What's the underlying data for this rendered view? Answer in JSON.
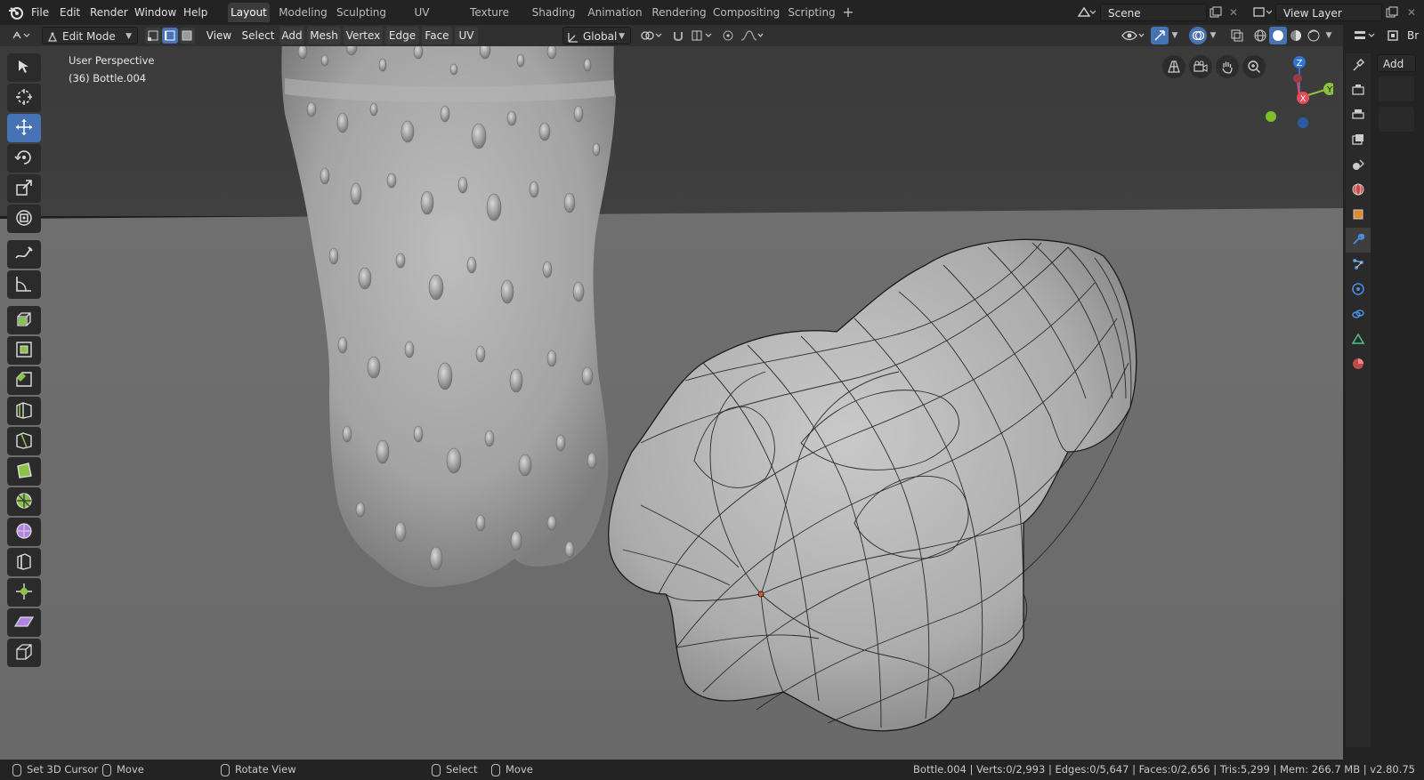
{
  "menubar": [
    "File",
    "Edit",
    "Render",
    "Window",
    "Help"
  ],
  "workspaces": {
    "active": "Layout",
    "tabs": [
      "Layout",
      "Modeling",
      "Sculpting",
      "UV Editing",
      "Texture Paint",
      "Shading",
      "Animation",
      "Rendering",
      "Compositing",
      "Scripting"
    ]
  },
  "scene": {
    "name": "Scene"
  },
  "view_layer": {
    "name": "View Layer"
  },
  "header": {
    "mode": "Edit Mode",
    "menus": [
      "View",
      "Select",
      "Add",
      "Mesh",
      "Vertex",
      "Edge",
      "Face",
      "UV"
    ],
    "orientation": "Global"
  },
  "viewport": {
    "perspective": "User Perspective",
    "object_label": "(36) Bottle.004",
    "axis_labels": {
      "z": "Z",
      "y": "Y",
      "x": "X"
    },
    "colors": {
      "background_top": "#3a3a3a",
      "floor": "#6b6b6b",
      "active_tool": "#4772b3",
      "axis_x": "#e44a5b",
      "axis_y": "#8cc43c",
      "axis_z": "#2f74d6"
    }
  },
  "tools": [
    "select-icon",
    "cursor-icon",
    "move-icon",
    "rotate-icon",
    "scale-icon",
    "transform-icon",
    "annotate-icon",
    "measure-icon",
    "extrude-icon",
    "inset-icon",
    "bevel-icon",
    "loop-cut-icon",
    "knife-icon",
    "poly-build-icon",
    "spin-icon",
    "smooth-icon",
    "edge-slide-icon",
    "shrink-fatten-icon",
    "shear-icon",
    "rip-icon"
  ],
  "sidebar": {
    "add_label": "Add",
    "cutoff_label": "Br"
  },
  "status": {
    "left": [
      {
        "label": "Set 3D Cursor"
      },
      {
        "label": "Move"
      },
      {
        "label": "Rotate View"
      },
      {
        "label": "Select"
      },
      {
        "label": "Move"
      }
    ],
    "info": "Bottle.004 | Verts:0/2,993 | Edges:0/5,647 | Faces:0/2,656 | Tris:5,299 | Mem: 266.7 MB | v2.80.75"
  }
}
